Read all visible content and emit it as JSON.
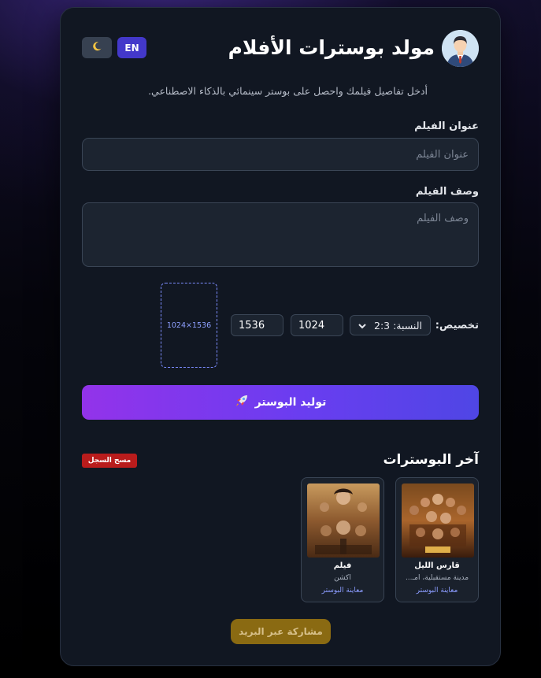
{
  "header": {
    "title": "مولد بوسترات الأفلام",
    "lang_button": "EN",
    "theme_icon": "moon-icon",
    "avatar_icon": "user-avatar-icon"
  },
  "subtitle": "أدخل تفاصيل فيلمك واحصل على بوستر سينمائي بالذكاء الاصطناعي.",
  "form": {
    "title_label": "عنوان الفيلم",
    "title_placeholder": "عنوان الفيلم",
    "title_value": "",
    "desc_label": "وصف الفيلم",
    "desc_placeholder": "وصف الفيلم",
    "desc_value": "",
    "custom_label": "تخصيص:",
    "ratio_value": "النسبة: 2:3",
    "width_value": "1024",
    "height_value": "1536",
    "preview_size": "1024×1536",
    "generate_label": "توليد البوستر",
    "generate_icon": "rocket-icon"
  },
  "recent": {
    "title": "آخر البوسترات",
    "clear_label": "مسح السجل",
    "items": [
      {
        "name": "قارس الليل",
        "desc": "مدينة مستقبلية، أمـ...",
        "link": "معاينة البوستر"
      },
      {
        "name": "فيلم",
        "desc": "اكشن",
        "link": "معاينة البوستر"
      }
    ]
  },
  "share_label": "مشاركة عبر البريد",
  "colors": {
    "accent": "#4f46e5",
    "accent2": "#9333ea",
    "danger": "#b91c1c",
    "share": "#8a6a12",
    "card_bg": "#111722"
  }
}
